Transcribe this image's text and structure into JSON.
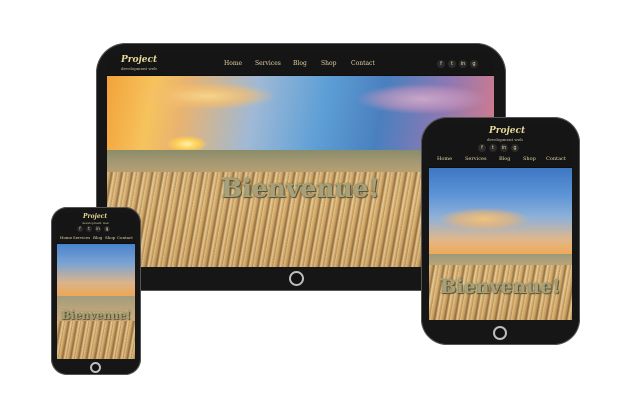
{
  "brand": {
    "name": "Project",
    "tagline": "development web"
  },
  "nav": {
    "items": [
      "Home",
      "Services",
      "Blog",
      "Shop",
      "Contact"
    ]
  },
  "social": {
    "icons": [
      "f",
      "t",
      "in",
      "g"
    ],
    "names": [
      "facebook-icon",
      "twitter-icon",
      "linkedin-icon",
      "google-icon"
    ]
  },
  "hero": {
    "welcome": "Bienvenue!"
  },
  "colors": {
    "accent": "#e6d99a",
    "frame": "#161616",
    "nav_bg": "#151515"
  }
}
